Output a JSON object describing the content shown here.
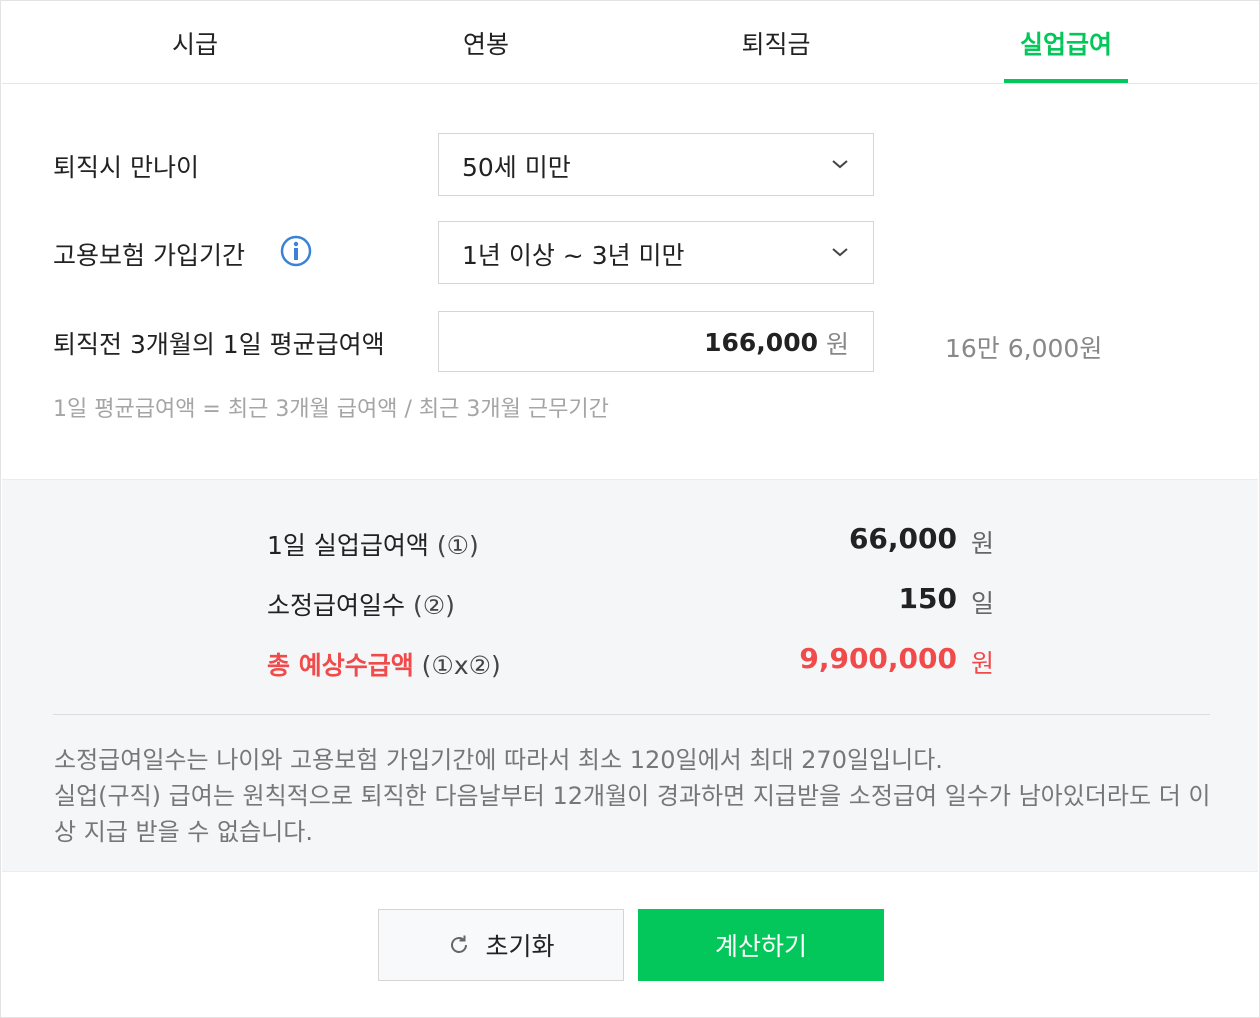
{
  "tabs": [
    {
      "label": "시급",
      "active": false
    },
    {
      "label": "연봉",
      "active": false
    },
    {
      "label": "퇴직금",
      "active": false
    },
    {
      "label": "실업급여",
      "active": true
    }
  ],
  "form": {
    "age_label": "퇴직시 만나이",
    "age_value": "50세 미만",
    "insurance_label": "고용보험 가입기간",
    "insurance_value": "1년 이상 ~ 3년 미만",
    "avg_wage_label": "퇴직전 3개월의 1일 평균급여액",
    "avg_wage_value": "166,000",
    "avg_wage_unit": "원",
    "avg_wage_korean": "16만 6,000원",
    "formula": "1일 평균급여액 = 최근 3개월 급여액 / 최근 3개월 근무기간"
  },
  "result": {
    "daily_label": "1일 실업급여액",
    "daily_ref": "(①)",
    "daily_value": "66,000",
    "daily_unit": "원",
    "days_label": "소정급여일수",
    "days_ref": "(②)",
    "days_value": "150",
    "days_unit": "일",
    "total_label": "총 예상수급액",
    "total_ref": "(①x②)",
    "total_value": "9,900,000",
    "total_unit": "원",
    "note_line1": "소정급여일수는 나이와 고용보험 가입기간에 따라서 최소 120일에서 최대 270일입니다.",
    "note_line2": "실업(구직) 급여는 원칙적으로 퇴직한 다음날부터 12개월이 경과하면 지급받을 소정급여 일수가 남아있더라도 더 이상 지급 받을 수 없습니다."
  },
  "buttons": {
    "reset_label": "초기화",
    "calc_label": "계산하기"
  },
  "colors": {
    "accent": "#03c75a",
    "total": "#f04a4a",
    "info": "#3b82d6"
  },
  "icons": {
    "select_arrow": "chevron-down-icon",
    "info": "info-icon",
    "reset": "refresh-icon"
  }
}
